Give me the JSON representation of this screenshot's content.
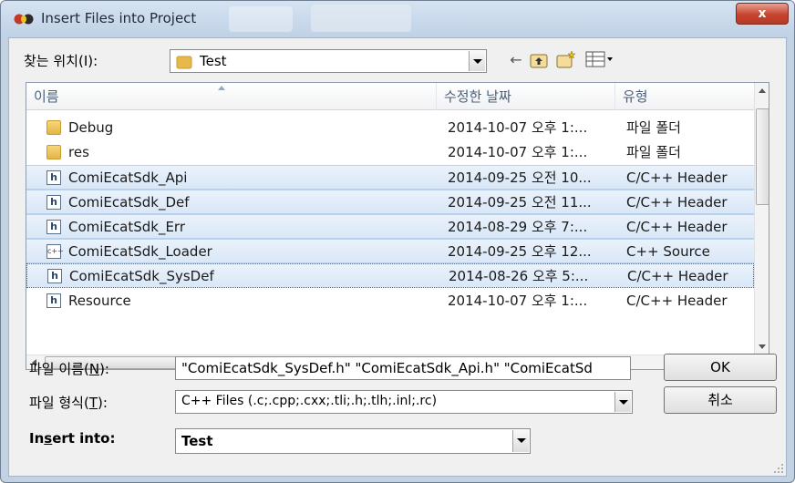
{
  "window": {
    "title": "Insert Files into Project",
    "close_label": "x"
  },
  "look_in": {
    "label": "찾는 위치(I):",
    "value": "Test"
  },
  "toolbar": {
    "back_icon": "back-arrow-icon",
    "up_icon": "up-folder-icon",
    "new_folder_icon": "new-folder-icon",
    "view_icon": "view-menu-icon"
  },
  "list": {
    "columns": [
      "이름",
      "수정한 날짜",
      "유형"
    ],
    "rows": [
      {
        "name": "Debug",
        "date": "2014-10-07 오후 1:...",
        "type": "파일 폴더",
        "icon": "folder-icon"
      },
      {
        "name": "res",
        "date": "2014-10-07 오후 1:...",
        "type": "파일 폴더",
        "icon": "folder-icon"
      },
      {
        "name": "ComiEcatSdk_Api",
        "date": "2014-09-25 오전 10...",
        "type": "C/C++ Header",
        "icon": "header-file-icon"
      },
      {
        "name": "ComiEcatSdk_Def",
        "date": "2014-09-25 오전 11...",
        "type": "C/C++ Header",
        "icon": "header-file-icon"
      },
      {
        "name": "ComiEcatSdk_Err",
        "date": "2014-08-29 오후 7:...",
        "type": "C/C++ Header",
        "icon": "header-file-icon"
      },
      {
        "name": "ComiEcatSdk_Loader",
        "date": "2014-09-25 오후 12...",
        "type": "C++ Source",
        "icon": "cpp-file-icon"
      },
      {
        "name": "ComiEcatSdk_SysDef",
        "date": "2014-08-26 오후 5:...",
        "type": "C/C++ Header",
        "icon": "header-file-icon"
      },
      {
        "name": "Resource",
        "date": "2014-10-07 오후 1:...",
        "type": "C/C++ Header",
        "icon": "header-file-icon"
      }
    ],
    "hscroll_grip": "III"
  },
  "filename": {
    "label_prefix": "파일 이름(",
    "label_key": "N",
    "label_suffix": "):",
    "value": "\"ComiEcatSdk_SysDef.h\" \"ComiEcatSdk_Api.h\" \"ComiEcatSd"
  },
  "filetype": {
    "label_prefix": "파일 형식(",
    "label_key": "T",
    "label_suffix": "):",
    "value": "C++ Files (.c;.cpp;.cxx;.tli;.h;.tlh;.inl;.rc)"
  },
  "insert_into": {
    "label_prefix": "In",
    "label_key": "s",
    "label_suffix": "ert into:",
    "value": "Test"
  },
  "buttons": {
    "ok": "OK",
    "cancel": "취소"
  },
  "colors": {
    "selection": "#d9e7f7",
    "title_bg": "#c3d2e3",
    "close": "#c7442e"
  }
}
